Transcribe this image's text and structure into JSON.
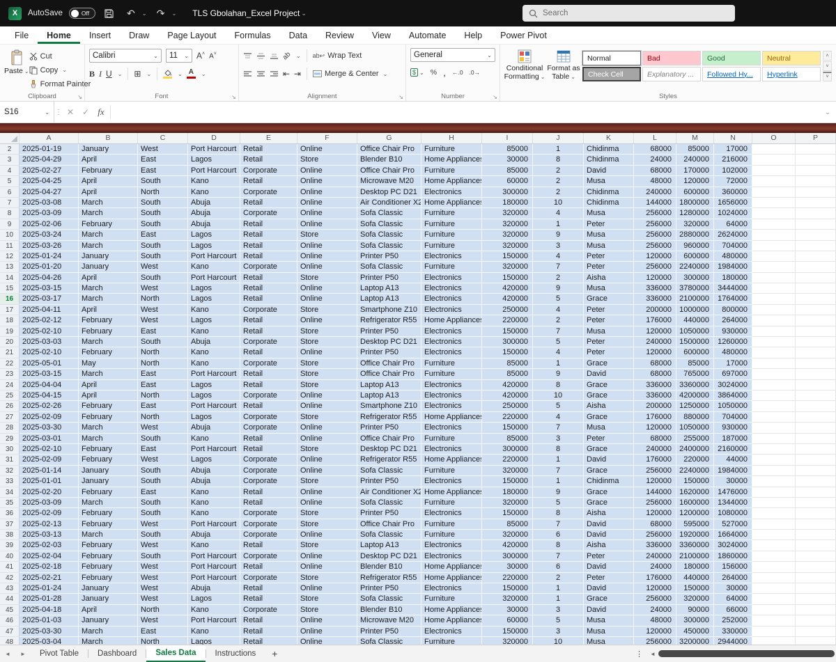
{
  "titlebar": {
    "app_name": "Excel",
    "autosave_label": "AutoSave",
    "autosave_state": "Off",
    "filename": "TLS Gbolahan_Excel Project",
    "search_placeholder": "Search"
  },
  "ribbon_tabs": [
    "File",
    "Home",
    "Insert",
    "Draw",
    "Page Layout",
    "Formulas",
    "Data",
    "Review",
    "View",
    "Automate",
    "Help",
    "Power Pivot"
  ],
  "active_tab": "Home",
  "ribbon": {
    "clipboard": {
      "label": "Clipboard",
      "paste": "Paste",
      "cut": "Cut",
      "copy": "Copy",
      "format_painter": "Format Painter"
    },
    "font": {
      "label": "Font",
      "font_name": "Calibri",
      "font_size": "11"
    },
    "alignment": {
      "label": "Alignment",
      "wrap_text": "Wrap Text",
      "merge_center": "Merge & Center"
    },
    "number": {
      "label": "Number",
      "format": "General"
    },
    "styles": {
      "label": "Styles",
      "conditional_formatting": "Conditional Formatting",
      "format_as_table": "Format as Table",
      "gallery": [
        "Normal",
        "Bad",
        "Good",
        "Neutral",
        "Check Cell",
        "Explanatory ...",
        "Followed Hy...",
        "Hyperlink"
      ]
    }
  },
  "formula_bar": {
    "name_box": "S16",
    "formula": ""
  },
  "sheet": {
    "columns": [
      "A",
      "B",
      "C",
      "D",
      "E",
      "F",
      "G",
      "H",
      "I",
      "J",
      "K",
      "L",
      "M",
      "N",
      "O",
      "P"
    ],
    "first_row_number": 2,
    "active_row_number": 16,
    "rows": [
      [
        "2025-01-19",
        "January",
        "West",
        "Port Harcourt",
        "Retail",
        "Online",
        "Office Chair Pro",
        "Furniture",
        "85000",
        "1",
        "Chidinma",
        "68000",
        "85000",
        "17000"
      ],
      [
        "2025-04-29",
        "April",
        "East",
        "Lagos",
        "Retail",
        "Store",
        "Blender B10",
        "Home Appliances",
        "30000",
        "8",
        "Chidinma",
        "24000",
        "240000",
        "216000"
      ],
      [
        "2025-02-27",
        "February",
        "East",
        "Port Harcourt",
        "Corporate",
        "Online",
        "Office Chair Pro",
        "Furniture",
        "85000",
        "2",
        "David",
        "68000",
        "170000",
        "102000"
      ],
      [
        "2025-04-25",
        "April",
        "South",
        "Kano",
        "Retail",
        "Online",
        "Microwave M20",
        "Home Appliances",
        "60000",
        "2",
        "Musa",
        "48000",
        "120000",
        "72000"
      ],
      [
        "2025-04-27",
        "April",
        "North",
        "Kano",
        "Corporate",
        "Online",
        "Desktop PC D21",
        "Electronics",
        "300000",
        "2",
        "Chidinma",
        "240000",
        "600000",
        "360000"
      ],
      [
        "2025-03-08",
        "March",
        "South",
        "Abuja",
        "Retail",
        "Online",
        "Air Conditioner X2",
        "Home Appliances",
        "180000",
        "10",
        "Chidinma",
        "144000",
        "1800000",
        "1656000"
      ],
      [
        "2025-03-09",
        "March",
        "South",
        "Abuja",
        "Corporate",
        "Online",
        "Sofa Classic",
        "Furniture",
        "320000",
        "4",
        "Musa",
        "256000",
        "1280000",
        "1024000"
      ],
      [
        "2025-02-06",
        "February",
        "South",
        "Abuja",
        "Retail",
        "Online",
        "Sofa Classic",
        "Furniture",
        "320000",
        "1",
        "Peter",
        "256000",
        "320000",
        "64000"
      ],
      [
        "2025-03-24",
        "March",
        "East",
        "Lagos",
        "Retail",
        "Store",
        "Sofa Classic",
        "Furniture",
        "320000",
        "9",
        "Musa",
        "256000",
        "2880000",
        "2624000"
      ],
      [
        "2025-03-26",
        "March",
        "South",
        "Lagos",
        "Retail",
        "Online",
        "Sofa Classic",
        "Furniture",
        "320000",
        "3",
        "Musa",
        "256000",
        "960000",
        "704000"
      ],
      [
        "2025-01-24",
        "January",
        "South",
        "Port Harcourt",
        "Retail",
        "Online",
        "Printer P50",
        "Electronics",
        "150000",
        "4",
        "Peter",
        "120000",
        "600000",
        "480000"
      ],
      [
        "2025-01-20",
        "January",
        "West",
        "Kano",
        "Corporate",
        "Online",
        "Sofa Classic",
        "Furniture",
        "320000",
        "7",
        "Peter",
        "256000",
        "2240000",
        "1984000"
      ],
      [
        "2025-04-26",
        "April",
        "South",
        "Port Harcourt",
        "Retail",
        "Store",
        "Printer P50",
        "Electronics",
        "150000",
        "2",
        "Aisha",
        "120000",
        "300000",
        "180000"
      ],
      [
        "2025-03-15",
        "March",
        "West",
        "Lagos",
        "Retail",
        "Online",
        "Laptop A13",
        "Electronics",
        "420000",
        "9",
        "Musa",
        "336000",
        "3780000",
        "3444000"
      ],
      [
        "2025-03-17",
        "March",
        "North",
        "Lagos",
        "Retail",
        "Online",
        "Laptop A13",
        "Electronics",
        "420000",
        "5",
        "Grace",
        "336000",
        "2100000",
        "1764000"
      ],
      [
        "2025-04-11",
        "April",
        "West",
        "Kano",
        "Corporate",
        "Store",
        "Smartphone Z10",
        "Electronics",
        "250000",
        "4",
        "Peter",
        "200000",
        "1000000",
        "800000"
      ],
      [
        "2025-02-12",
        "February",
        "West",
        "Lagos",
        "Retail",
        "Online",
        "Refrigerator R55",
        "Home Appliances",
        "220000",
        "2",
        "Peter",
        "176000",
        "440000",
        "264000"
      ],
      [
        "2025-02-10",
        "February",
        "East",
        "Kano",
        "Retail",
        "Store",
        "Printer P50",
        "Electronics",
        "150000",
        "7",
        "Musa",
        "120000",
        "1050000",
        "930000"
      ],
      [
        "2025-03-03",
        "March",
        "South",
        "Abuja",
        "Corporate",
        "Store",
        "Desktop PC D21",
        "Electronics",
        "300000",
        "5",
        "Peter",
        "240000",
        "1500000",
        "1260000"
      ],
      [
        "2025-02-10",
        "February",
        "North",
        "Kano",
        "Retail",
        "Online",
        "Printer P50",
        "Electronics",
        "150000",
        "4",
        "Peter",
        "120000",
        "600000",
        "480000"
      ],
      [
        "2025-05-01",
        "May",
        "North",
        "Kano",
        "Corporate",
        "Store",
        "Office Chair Pro",
        "Furniture",
        "85000",
        "1",
        "Grace",
        "68000",
        "85000",
        "17000"
      ],
      [
        "2025-03-15",
        "March",
        "East",
        "Port Harcourt",
        "Retail",
        "Store",
        "Office Chair Pro",
        "Furniture",
        "85000",
        "9",
        "David",
        "68000",
        "765000",
        "697000"
      ],
      [
        "2025-04-04",
        "April",
        "East",
        "Lagos",
        "Retail",
        "Store",
        "Laptop A13",
        "Electronics",
        "420000",
        "8",
        "Grace",
        "336000",
        "3360000",
        "3024000"
      ],
      [
        "2025-04-15",
        "April",
        "North",
        "Lagos",
        "Corporate",
        "Online",
        "Laptop A13",
        "Electronics",
        "420000",
        "10",
        "Grace",
        "336000",
        "4200000",
        "3864000"
      ],
      [
        "2025-02-26",
        "February",
        "East",
        "Port Harcourt",
        "Retail",
        "Online",
        "Smartphone Z10",
        "Electronics",
        "250000",
        "5",
        "Aisha",
        "200000",
        "1250000",
        "1050000"
      ],
      [
        "2025-02-09",
        "February",
        "North",
        "Lagos",
        "Corporate",
        "Store",
        "Refrigerator R55",
        "Home Appliances",
        "220000",
        "4",
        "Grace",
        "176000",
        "880000",
        "704000"
      ],
      [
        "2025-03-30",
        "March",
        "West",
        "Abuja",
        "Corporate",
        "Online",
        "Printer P50",
        "Electronics",
        "150000",
        "7",
        "Musa",
        "120000",
        "1050000",
        "930000"
      ],
      [
        "2025-03-01",
        "March",
        "South",
        "Kano",
        "Retail",
        "Online",
        "Office Chair Pro",
        "Furniture",
        "85000",
        "3",
        "Peter",
        "68000",
        "255000",
        "187000"
      ],
      [
        "2025-02-10",
        "February",
        "East",
        "Port Harcourt",
        "Retail",
        "Store",
        "Desktop PC D21",
        "Electronics",
        "300000",
        "8",
        "Grace",
        "240000",
        "2400000",
        "2160000"
      ],
      [
        "2025-02-09",
        "February",
        "West",
        "Lagos",
        "Corporate",
        "Online",
        "Refrigerator R55",
        "Home Appliances",
        "220000",
        "1",
        "David",
        "176000",
        "220000",
        "44000"
      ],
      [
        "2025-01-14",
        "January",
        "South",
        "Abuja",
        "Corporate",
        "Online",
        "Sofa Classic",
        "Furniture",
        "320000",
        "7",
        "Grace",
        "256000",
        "2240000",
        "1984000"
      ],
      [
        "2025-01-01",
        "January",
        "South",
        "Abuja",
        "Corporate",
        "Store",
        "Printer P50",
        "Electronics",
        "150000",
        "1",
        "Chidinma",
        "120000",
        "150000",
        "30000"
      ],
      [
        "2025-02-20",
        "February",
        "East",
        "Kano",
        "Retail",
        "Online",
        "Air Conditioner X2",
        "Home Appliances",
        "180000",
        "9",
        "Grace",
        "144000",
        "1620000",
        "1476000"
      ],
      [
        "2025-03-09",
        "March",
        "South",
        "Kano",
        "Retail",
        "Online",
        "Sofa Classic",
        "Furniture",
        "320000",
        "5",
        "Grace",
        "256000",
        "1600000",
        "1344000"
      ],
      [
        "2025-02-09",
        "February",
        "South",
        "Kano",
        "Corporate",
        "Store",
        "Printer P50",
        "Electronics",
        "150000",
        "8",
        "Aisha",
        "120000",
        "1200000",
        "1080000"
      ],
      [
        "2025-02-13",
        "February",
        "West",
        "Port Harcourt",
        "Corporate",
        "Store",
        "Office Chair Pro",
        "Furniture",
        "85000",
        "7",
        "David",
        "68000",
        "595000",
        "527000"
      ],
      [
        "2025-03-13",
        "March",
        "South",
        "Abuja",
        "Corporate",
        "Online",
        "Sofa Classic",
        "Furniture",
        "320000",
        "6",
        "David",
        "256000",
        "1920000",
        "1664000"
      ],
      [
        "2025-02-03",
        "February",
        "West",
        "Kano",
        "Retail",
        "Store",
        "Laptop A13",
        "Electronics",
        "420000",
        "8",
        "Aisha",
        "336000",
        "3360000",
        "3024000"
      ],
      [
        "2025-02-04",
        "February",
        "South",
        "Port Harcourt",
        "Corporate",
        "Online",
        "Desktop PC D21",
        "Electronics",
        "300000",
        "7",
        "Peter",
        "240000",
        "2100000",
        "1860000"
      ],
      [
        "2025-02-18",
        "February",
        "West",
        "Port Harcourt",
        "Retail",
        "Online",
        "Blender B10",
        "Home Appliances",
        "30000",
        "6",
        "David",
        "24000",
        "180000",
        "156000"
      ],
      [
        "2025-02-21",
        "February",
        "West",
        "Port Harcourt",
        "Corporate",
        "Store",
        "Refrigerator R55",
        "Home Appliances",
        "220000",
        "2",
        "Peter",
        "176000",
        "440000",
        "264000"
      ],
      [
        "2025-01-24",
        "January",
        "West",
        "Abuja",
        "Retail",
        "Online",
        "Printer P50",
        "Electronics",
        "150000",
        "1",
        "David",
        "120000",
        "150000",
        "30000"
      ],
      [
        "2025-01-28",
        "January",
        "West",
        "Lagos",
        "Retail",
        "Store",
        "Sofa Classic",
        "Furniture",
        "320000",
        "1",
        "Grace",
        "256000",
        "320000",
        "64000"
      ],
      [
        "2025-04-18",
        "April",
        "North",
        "Kano",
        "Corporate",
        "Store",
        "Blender B10",
        "Home Appliances",
        "30000",
        "3",
        "David",
        "24000",
        "90000",
        "66000"
      ],
      [
        "2025-01-03",
        "January",
        "West",
        "Port Harcourt",
        "Retail",
        "Online",
        "Microwave M20",
        "Home Appliances",
        "60000",
        "5",
        "Musa",
        "48000",
        "300000",
        "252000"
      ],
      [
        "2025-03-30",
        "March",
        "East",
        "Kano",
        "Retail",
        "Online",
        "Printer P50",
        "Electronics",
        "150000",
        "3",
        "Musa",
        "120000",
        "450000",
        "330000"
      ],
      [
        "2025-03-04",
        "March",
        "North",
        "Lagos",
        "Retail",
        "Online",
        "Sofa Classic",
        "Furniture",
        "320000",
        "10",
        "Musa",
        "256000",
        "3200000",
        "2944000"
      ]
    ]
  },
  "sheet_tabs": {
    "tabs": [
      "Pivot Table",
      "Dashboard",
      "Sales Data",
      "Instructions"
    ],
    "active": "Sales Data"
  },
  "icons": {
    "chevron_down": "⌄",
    "undo": "↶",
    "redo": "↷",
    "ellipsis_v": "⋮",
    "nav_left": "◄",
    "nav_right": "►",
    "dialog_launcher": "↘",
    "bold": "B",
    "italic": "I",
    "underline": "U",
    "borders": "⊞",
    "accounting": "$",
    "percent": "%",
    "comma": ",",
    "increase_decimal": "←.0",
    "decrease_decimal": ".0→",
    "letter_a": "A",
    "tri_up": "˄",
    "tri_down": "˅",
    "wrap_ab": "ab",
    "return_arrow": "↩",
    "orientation_ab": "ab",
    "indent_decrease": "⇤",
    "indent_increase": "⇥",
    "fx": "fx",
    "cancel": "✕",
    "enter": "✓",
    "add": "+",
    "app_initial": "X"
  },
  "colors": {
    "accent_green": "#107c41",
    "selection_blue": "#d0dff2",
    "titlebar_black": "#121212",
    "divider_maroon": "#7c342a"
  }
}
